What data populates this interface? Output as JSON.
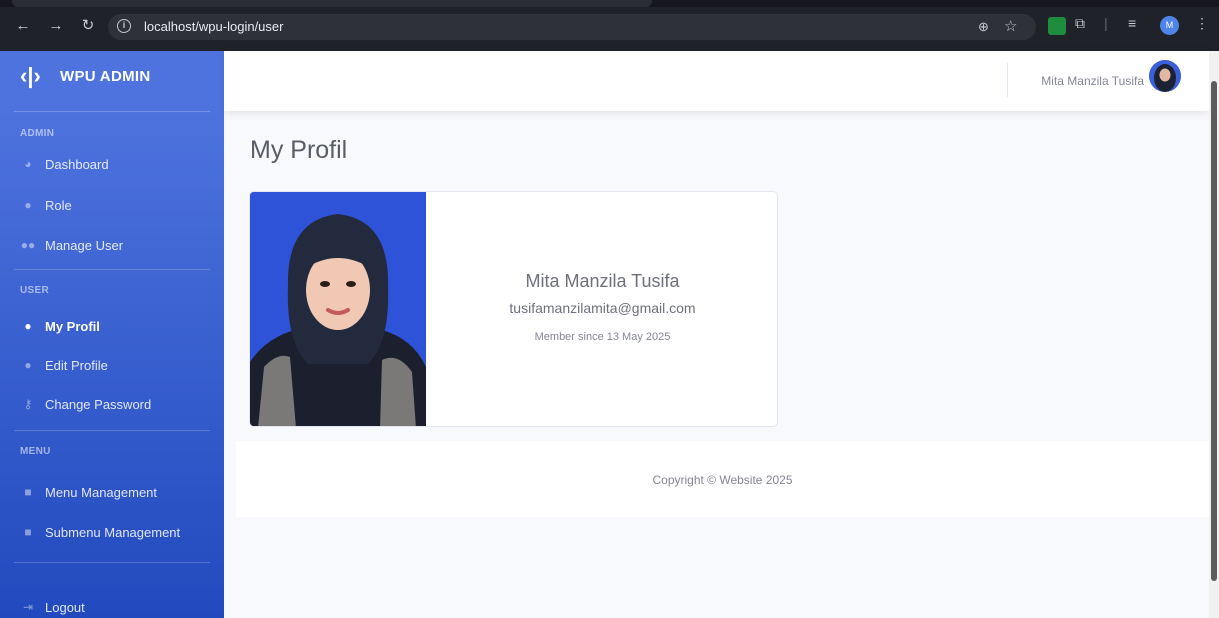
{
  "browser": {
    "url": "localhost/wpu-login/user",
    "profile_initial": "M"
  },
  "sidebar": {
    "brand_logo": "‹|›",
    "brand_text": "WPU ADMIN",
    "sections": {
      "admin_heading": "ADMIN",
      "user_heading": "USER",
      "menu_heading": "MENU"
    },
    "items": [
      {
        "label": "Dashboard",
        "icon": "dashboard-icon"
      },
      {
        "label": "Role",
        "icon": "user-tie-icon"
      },
      {
        "label": "Manage User",
        "icon": "users-icon"
      },
      {
        "label": "My Profil",
        "icon": "user-icon",
        "active": true
      },
      {
        "label": "Edit Profile",
        "icon": "user-edit-icon"
      },
      {
        "label": "Change Password",
        "icon": "key-icon"
      },
      {
        "label": "Menu Management",
        "icon": "folder-icon"
      },
      {
        "label": "Submenu Management",
        "icon": "folder-open-icon"
      },
      {
        "label": "Logout",
        "icon": "logout-icon"
      }
    ]
  },
  "topbar": {
    "user_name": "Mita Manzila Tusifa"
  },
  "main": {
    "page_title": "My Profil",
    "profile": {
      "name": "Mita Manzila Tusifa",
      "email": "tusifamanzilamita@gmail.com",
      "member_since": "Member since 13 May 2025"
    }
  },
  "footer": {
    "copyright": "Copyright © Website 2025"
  },
  "colors": {
    "sidebar_top": "#4e73df",
    "sidebar_bottom": "#224abe",
    "photo_bg": "#2f53d8"
  }
}
